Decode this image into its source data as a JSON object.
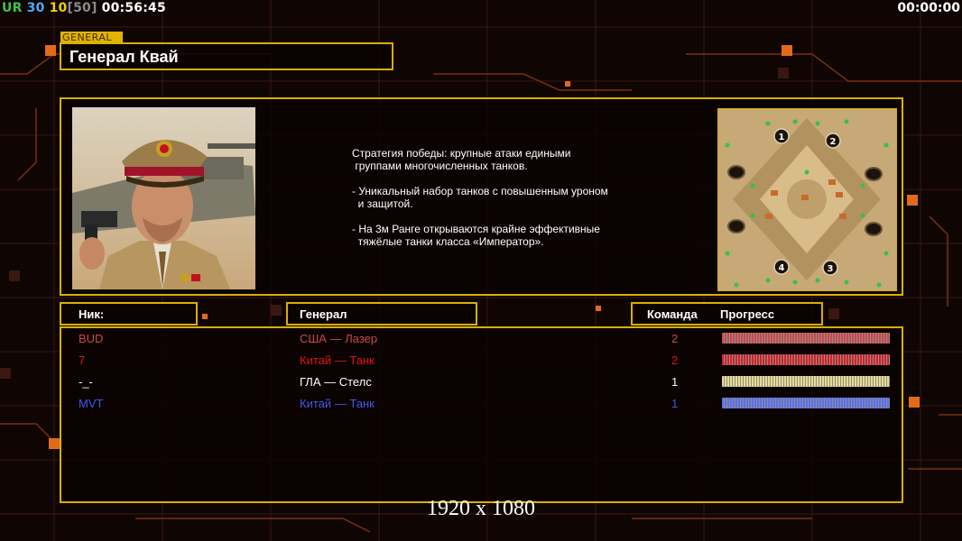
{
  "hud": {
    "ur_label": "UR",
    "fps": "30",
    "ping": "10",
    "bracket_value": "[50]",
    "elapsed": "00:56:45",
    "timer": "00:00:00"
  },
  "general_panel": {
    "tag": "GENERAL",
    "name": "Генерал Квай",
    "description": [
      "Стратегия победы: крупные атаки едиными\n группами многочисленных танков.",
      "- Уникальный набор танков с повышенным уроном\n  и защитой.",
      "- На 3м Ранге открываются крайне эффективные\n  тяжёлые танки класса «Император»."
    ]
  },
  "minimap": {
    "start_positions": [
      "1",
      "2",
      "3",
      "4"
    ]
  },
  "headers": {
    "nick": "Ник:",
    "general": "Генерал",
    "team": "Команда",
    "progress": "Прогресс"
  },
  "players": [
    {
      "nick": "BUD",
      "general": "США — Лазер",
      "team": "2",
      "color": "#c9484a",
      "progress": 1.0
    },
    {
      "nick": "7",
      "general": "Китай — Танк",
      "team": "2",
      "color": "#e0141e",
      "progress": 1.0
    },
    {
      "nick": "-_-",
      "general": "ГЛА — Стелс",
      "team": "1",
      "color": "#ffffff",
      "progress": 1.0
    },
    {
      "nick": "MVT",
      "general": "Китай — Танк",
      "team": "1",
      "color": "#3f57e8",
      "progress": 1.0
    }
  ],
  "colors": {
    "accent": "#d9b000",
    "bar_red": "#c94a4a",
    "bar_darkred": "#d2222a",
    "bar_yellow": "#e8dc8e",
    "bar_blue": "#5a6ff0"
  },
  "watermark": "1920 x 1080"
}
